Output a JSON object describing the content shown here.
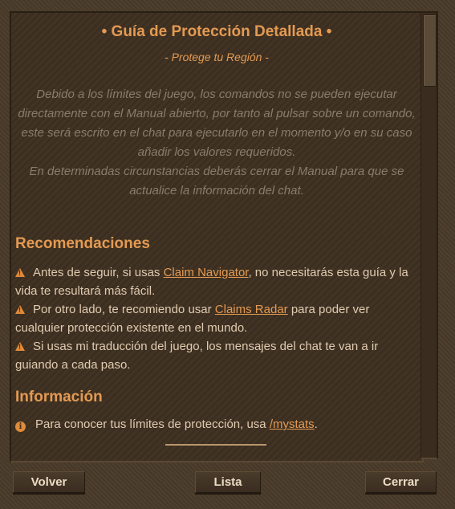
{
  "header": {
    "title": "• Guía de Protección Detallada •",
    "subtitle": "-  Protege tu Región -"
  },
  "intro": {
    "line1": "Debido a los límites del juego, los comandos no se pueden ejecutar directamente con el Manual abierto, por tanto al pulsar sobre un comando, este será escrito en el chat para ejecutarlo en el momento y/o en su caso añadir los valores requeridos.",
    "line2": "En determinadas circunstancias deberás cerrar el Manual para que se actualice la información del chat."
  },
  "recomendaciones": {
    "heading": "Recomendaciones",
    "items": [
      {
        "before": "Antes de seguir, si usas ",
        "link": "Claim Navigator",
        "after": ", no necesitarás esta guía y la vida te resultará más fácil."
      },
      {
        "before": "Por otro lado, te recomiendo usar ",
        "link": "Claims Radar",
        "after": " para poder ver cualquier protección existente en el mundo."
      },
      {
        "before": "Si usas mi traducción del juego, los mensajes del chat te van a ir guiando a cada paso.",
        "link": "",
        "after": ""
      }
    ]
  },
  "informacion": {
    "heading": "Información",
    "items": [
      {
        "before": "Para conocer tus límites de protección, usa ",
        "link": "/mystats",
        "after": "."
      }
    ]
  },
  "footer": {
    "back_label": "Volver",
    "list_label": "Lista",
    "close_label": "Cerrar"
  },
  "icons": {
    "warning": "warning-icon",
    "info": "info-icon"
  },
  "colors": {
    "accent": "#e49a52",
    "text": "#e0cbb0",
    "muted": "#8a7c6c",
    "background": "#3f3122"
  }
}
